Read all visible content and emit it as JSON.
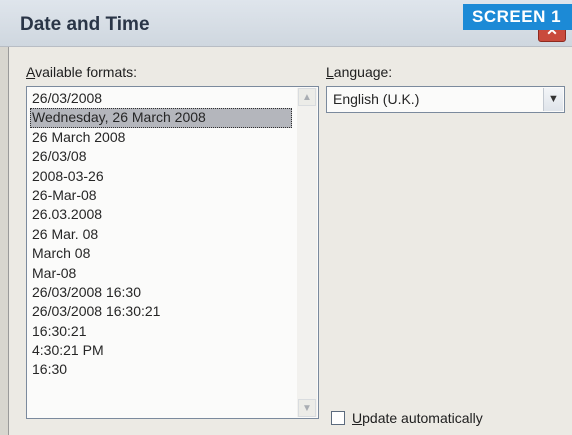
{
  "window": {
    "title": "Date and Time",
    "tag": "SCREEN 1",
    "close_glyph": "✕"
  },
  "formats": {
    "label_accel": "A",
    "label_rest": "vailable formats:",
    "items": [
      "26/03/2008",
      "Wednesday, 26 March 2008",
      "26 March 2008",
      "26/03/08",
      "2008-03-26",
      "26-Mar-08",
      "26.03.2008",
      "26 Mar. 08",
      "March 08",
      "Mar-08",
      "26/03/2008 16:30",
      "26/03/2008 16:30:21",
      "16:30:21",
      "4:30:21 PM",
      "16:30"
    ],
    "selected_index": 1
  },
  "language": {
    "label_accel": "L",
    "label_rest": "anguage:",
    "value": "English (U.K.)"
  },
  "update": {
    "label_accel": "U",
    "label_rest": "pdate automatically",
    "checked": false
  },
  "icons": {
    "scroll_up": "scroll-up-arrow-icon",
    "scroll_down": "scroll-down-arrow-icon",
    "dropdown": "chevron-down-icon",
    "close": "close-icon"
  },
  "colors": {
    "tag_background": "#1c8ad6",
    "selection_highlight": "#b4b6bc"
  }
}
